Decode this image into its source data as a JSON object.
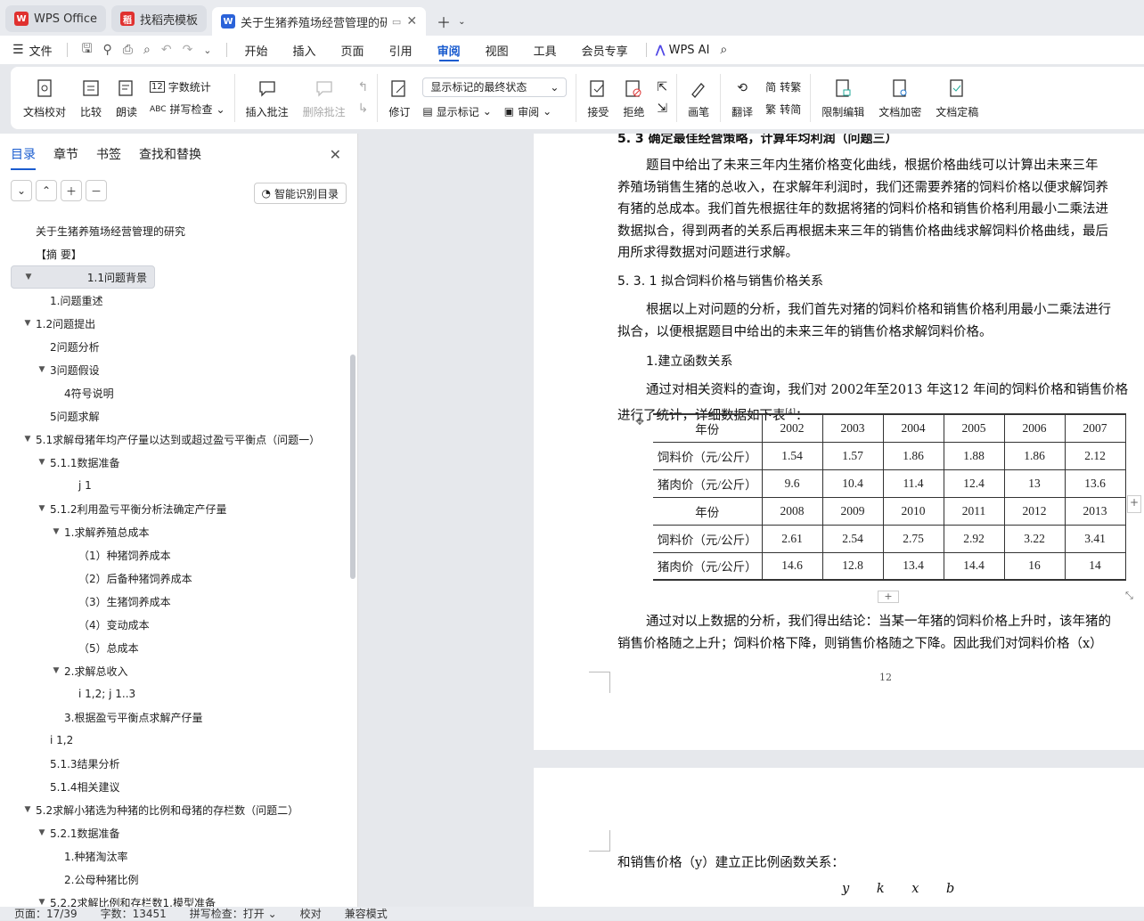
{
  "tabs": [
    {
      "label": "WPS Office",
      "icon": "wps-logo-icon",
      "color": "#e0312f"
    },
    {
      "label": "找稻壳模板",
      "icon": "docer-logo-icon",
      "color": "#e0312f"
    },
    {
      "label": "关于生猪养殖场经营管理的研究",
      "icon": "word-doc-icon",
      "color": "#2b63d9"
    }
  ],
  "menu": {
    "file": "文件",
    "items": [
      "开始",
      "插入",
      "页面",
      "引用",
      "审阅",
      "视图",
      "工具",
      "会员专享"
    ],
    "active": "审阅",
    "wps_ai": "WPS AI"
  },
  "ribbon": {
    "doc_check": "文档校对",
    "compare": "比较",
    "read": "朗读",
    "word_count": "字数统计",
    "spell_check": "拼写检查",
    "insert_comment": "插入批注",
    "delete_comment": "删除批注",
    "track": "修订",
    "markup_mode": "显示标记的最终状态",
    "show_markup": "显示标记",
    "review": "审阅",
    "accept": "接受",
    "reject": "拒绝",
    "pen": "画笔",
    "translate": "翻译",
    "to_trad": "转繁",
    "to_simp": "转简",
    "restrict_edit": "限制编辑",
    "encrypt": "文档加密",
    "finalize": "文档定稿"
  },
  "sidebar": {
    "tabs": [
      "目录",
      "章节",
      "书签",
      "查找和替换"
    ],
    "active_tab": "目录",
    "smart_toc": "智能识别目录",
    "toc": [
      {
        "label": "关于生猪养殖场经营管理的研究",
        "level": 0,
        "arrow": ""
      },
      {
        "label": "【摘 要】",
        "level": 0,
        "arrow": ""
      },
      {
        "label": "1.1问题背景",
        "level": 0,
        "arrow": "down",
        "selected": true
      },
      {
        "label": "1.问题重述",
        "level": 1,
        "arrow": ""
      },
      {
        "label": "1.2问题提出",
        "level": 0,
        "arrow": "down"
      },
      {
        "label": "2问题分析",
        "level": 1,
        "arrow": ""
      },
      {
        "label": "3问题假设",
        "level": 1,
        "arrow": "down"
      },
      {
        "label": "4符号说明",
        "level": 2,
        "arrow": ""
      },
      {
        "label": "5问题求解",
        "level": 1,
        "arrow": ""
      },
      {
        "label": "5.1求解母猪年均产仔量以达到或超过盈亏平衡点（问题一）",
        "level": 0,
        "arrow": "down"
      },
      {
        "label": "5.1.1数据准备",
        "level": 1,
        "arrow": "down"
      },
      {
        "label": "j 1",
        "level": 3,
        "arrow": ""
      },
      {
        "label": "5.1.2利用盈亏平衡分析法确定产仔量",
        "level": 1,
        "arrow": "down"
      },
      {
        "label": "1.求解养殖总成本",
        "level": 2,
        "arrow": "down"
      },
      {
        "label": "（1）种猪饲养成本",
        "level": 3,
        "arrow": ""
      },
      {
        "label": "（2）后备种猪饲养成本",
        "level": 3,
        "arrow": ""
      },
      {
        "label": "（3）生猪饲养成本",
        "level": 3,
        "arrow": ""
      },
      {
        "label": "（4）变动成本",
        "level": 3,
        "arrow": ""
      },
      {
        "label": "（5）总成本",
        "level": 3,
        "arrow": ""
      },
      {
        "label": "2.求解总收入",
        "level": 2,
        "arrow": "down"
      },
      {
        "label": "i 1,2; j 1..3",
        "level": 3,
        "arrow": ""
      },
      {
        "label": "3.根据盈亏平衡点求解产仔量",
        "level": 2,
        "arrow": ""
      },
      {
        "label": "i 1,2",
        "level": 1,
        "arrow": ""
      },
      {
        "label": "5.1.3结果分析",
        "level": 1,
        "arrow": ""
      },
      {
        "label": "5.1.4相关建议",
        "level": 1,
        "arrow": ""
      },
      {
        "label": "5.2求解小猪选为种猪的比例和母猪的存栏数（问题二）",
        "level": 0,
        "arrow": "down"
      },
      {
        "label": "5.2.1数据准备",
        "level": 1,
        "arrow": "down"
      },
      {
        "label": "1.种猪淘汰率",
        "level": 2,
        "arrow": ""
      },
      {
        "label": "2.公母种猪比例",
        "level": 2,
        "arrow": ""
      },
      {
        "label": "5.2.2求解比例和存栏数1.模型准备",
        "level": 1,
        "arrow": "down"
      }
    ]
  },
  "document": {
    "heading_53": "5. 3 确定最佳经营策略，计算年均利润（问题三）",
    "para1": [
      "题目中给出了未来三年内生猪价格变化曲线，根据价格曲线可以计算出未来三年",
      "养殖场销售生猪的总收入，在求解年利润时，我们还需要养猪的饲料价格以便求解饲养",
      "有猪的总成本。我们首先根据往年的数据将猪的饲料价格和销售价格利用最小二乘法进",
      "数据拟合，得到两者的关系后再根据未来三年的销售价格曲线求解饲料价格曲线，最后",
      "用所求得数据对问题进行求解。"
    ],
    "heading_531": "5. 3. 1 拟合饲料价格与销售价格关系",
    "para2": [
      "根据以上对问题的分析，我们首先对猪的饲料价格和销售价格利用最小二乘法进行",
      "拟合，以便根据题目中给出的未来三年的销售价格求解饲料价格。"
    ],
    "sub1": "1.建立函数关系",
    "para3": [
      "通过对相关资料的查询，我们对 2002年至2013 年这12 年间的饲料价格和销售价格",
      "进行了统计，详细数据如下表"
    ],
    "cite": "[4]",
    "colon": "：",
    "table": [
      [
        "年份",
        "2002",
        "2003",
        "2004",
        "2005",
        "2006",
        "2007"
      ],
      [
        "饲料价（元/公斤）",
        "1.54",
        "1.57",
        "1.86",
        "1.88",
        "1.86",
        "2.12"
      ],
      [
        "猪肉价（元/公斤）",
        "9.6",
        "10.4",
        "11.4",
        "12.4",
        "13",
        "13.6"
      ],
      [
        "年份",
        "2008",
        "2009",
        "2010",
        "2011",
        "2012",
        "2013"
      ],
      [
        "饲料价（元/公斤）",
        "2.61",
        "2.54",
        "2.75",
        "2.92",
        "3.22",
        "3.41"
      ],
      [
        "猪肉价（元/公斤）",
        "14.6",
        "12.8",
        "13.4",
        "14.4",
        "16",
        "14"
      ]
    ],
    "para4": [
      "通过对以上数据的分析，我们得出结论：当某一年猪的饲料价格上升时，该年猪的",
      "销售价格随之上升；饲料价格下降，则销售价格随之下降。因此我们对饲料价格（x）"
    ],
    "page_number": "12",
    "para5": "和销售价格（y）建立正比例函数关系：",
    "formula": [
      "y",
      "k",
      "x",
      "b"
    ]
  },
  "status": {
    "page": "页面：17/39",
    "words": "字数：13451",
    "spell": "拼写检查：打开",
    "proof": "校对",
    "compat": "兼容模式"
  }
}
